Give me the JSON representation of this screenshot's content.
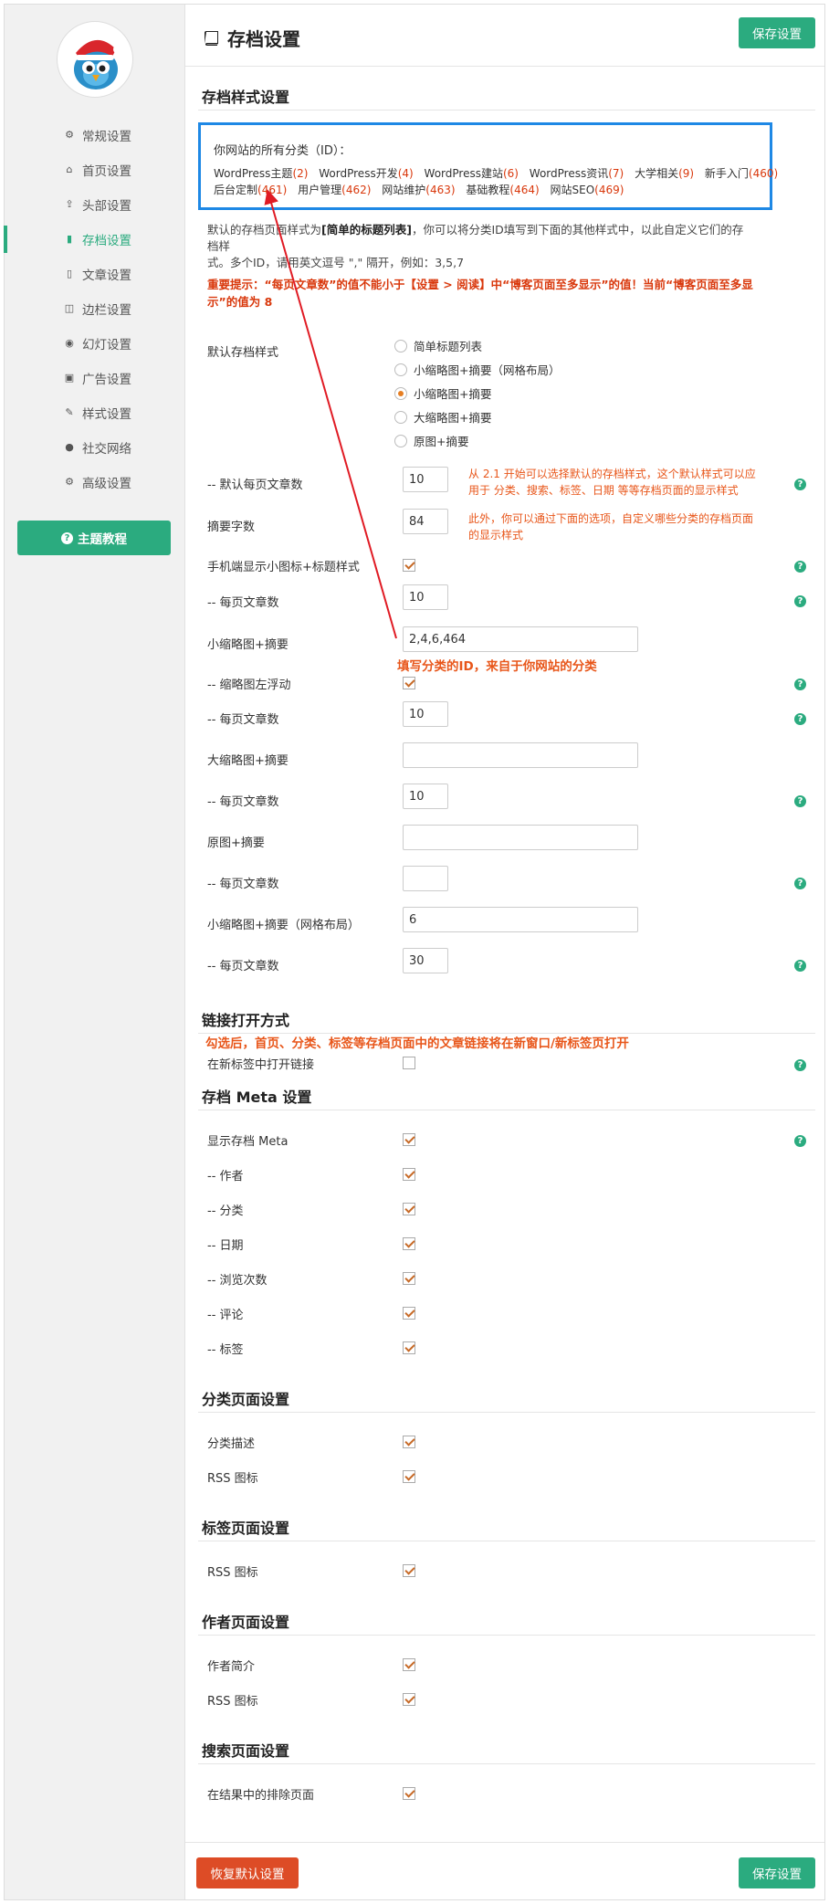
{
  "app": {
    "page_title": "存档设置"
  },
  "sidebar": {
    "items": [
      {
        "label": "常规设置",
        "icon": "gear-icon"
      },
      {
        "label": "首页设置",
        "icon": "home-icon"
      },
      {
        "label": "头部设置",
        "icon": "upload-icon"
      },
      {
        "label": "存档设置",
        "icon": "book-icon",
        "active": true
      },
      {
        "label": "文章设置",
        "icon": "file-icon"
      },
      {
        "label": "边栏设置",
        "icon": "columns-icon"
      },
      {
        "label": "幻灯设置",
        "icon": "play-circle-icon"
      },
      {
        "label": "广告设置",
        "icon": "gift-icon"
      },
      {
        "label": "样式设置",
        "icon": "magic-wand-icon"
      },
      {
        "label": "社交网络",
        "icon": "globe-icon"
      },
      {
        "label": "高级设置",
        "icon": "gears-icon"
      }
    ],
    "tutorial_label": "主题教程"
  },
  "toolbar": {
    "save_label": "保存设置",
    "reset_label": "恢复默认设置"
  },
  "archive_style": {
    "section_title": "存档样式设置",
    "category_box_title": "你网站的所有分类（ID）：",
    "categories_row1": [
      {
        "name": "WordPress主题",
        "id": "(2)"
      },
      {
        "name": "WordPress开发",
        "id": "(4)"
      },
      {
        "name": "WordPress建站",
        "id": "(6)"
      },
      {
        "name": "WordPress资讯",
        "id": "(7)"
      },
      {
        "name": "大学相关",
        "id": "(9)"
      },
      {
        "name": "新手入门",
        "id": "(460)"
      }
    ],
    "categories_row2": [
      {
        "name": "后台定制",
        "id": "(461)"
      },
      {
        "name": "用户管理",
        "id": "(462)"
      },
      {
        "name": "网站维护",
        "id": "(463)"
      },
      {
        "name": "基础教程",
        "id": "(464)"
      },
      {
        "name": "网站SEO",
        "id": "(469)"
      }
    ],
    "desc_prefix": "默认的存档页面样式为",
    "desc_bold": "[简单的标题列表]",
    "desc_line1_rest": "，你可以将分类ID填写到下面的其他样式中，以此自定义它们的存档样",
    "desc_line2": "式。多个ID，请用英文逗号 \",\" 隔开，例如：3,5,7",
    "warning_line1": "重要提示：“每页文章数”的值不能小于【设置 > 阅读】中“博客页面至多显示”的值！当前“博客页面至多显",
    "warning_line2": "示”的值为 8",
    "default_style_label": "默认存档样式",
    "style_options": [
      "简单标题列表",
      "小缩略图+摘要（网格布局）",
      "小缩略图+摘要",
      "大缩略图+摘要",
      "原图+摘要"
    ],
    "selected_style": "小缩略图+摘要",
    "fields": {
      "default_per_page_label": "-- 默认每页文章数",
      "default_per_page_value": "10",
      "excerpt_len_label": "摘要字数",
      "excerpt_len_value": "84",
      "mobile_small_label": "手机端显示小图标+标题样式",
      "mobile_per_page_label": "-- 每页文章数",
      "mobile_per_page_value": "10",
      "small_thumb_label": "小缩略图+摘要",
      "small_thumb_value": "2,4,6,464",
      "thumb_float_label": "-- 缩略图左浮动",
      "small_per_page_label": "-- 每页文章数",
      "small_per_page_value": "10",
      "large_thumb_label": "大缩略图+摘要",
      "large_thumb_value": "",
      "large_per_page_label": "-- 每页文章数",
      "large_per_page_value": "10",
      "original_label": "原图+摘要",
      "original_value": "",
      "original_per_page_label": "-- 每页文章数",
      "original_per_page_value": "",
      "grid_label": "小缩略图+摘要（网格布局）",
      "grid_value": "6",
      "grid_per_page_label": "-- 每页文章数",
      "grid_per_page_value": "30"
    },
    "notes": {
      "note1_line1": "从 2.1 开始可以选择默认的存档样式，这个默认样式可以应",
      "note1_line2": "用于 分类、搜索、标签、日期 等等存档页面的显示样式",
      "note2_line1": "此外，你可以通过下面的选项，自定义哪些分类的存档页面",
      "note2_line2": "的显示样式",
      "note3": "填写分类的ID，来自于你网站的分类"
    }
  },
  "link_open": {
    "section_title": "链接打开方式",
    "note": "勾选后，首页、分类、标签等存档页面中的文章链接将在新窗口/新标签页打开",
    "new_tab_label": "在新标签中打开链接"
  },
  "archive_meta": {
    "section_title": "存档 Meta 设置",
    "items": [
      "显示存档 Meta",
      "-- 作者",
      "-- 分类",
      "-- 日期",
      "-- 浏览次数",
      "-- 评论",
      "-- 标签"
    ]
  },
  "category_page": {
    "section_title": "分类页面设置",
    "items": [
      "分类描述",
      "RSS 图标"
    ]
  },
  "tag_page": {
    "section_title": "标签页面设置",
    "items": [
      "RSS 图标"
    ]
  },
  "author_page": {
    "section_title": "作者页面设置",
    "items": [
      "作者简介",
      "RSS 图标"
    ]
  },
  "search_page": {
    "section_title": "搜索页面设置",
    "items": [
      "在结果中的排除页面"
    ]
  },
  "colors": {
    "accent": "#2bab7f",
    "danger": "#dd4c26",
    "annotation": "#e8561a",
    "highlight_box": "#1e88e5"
  }
}
